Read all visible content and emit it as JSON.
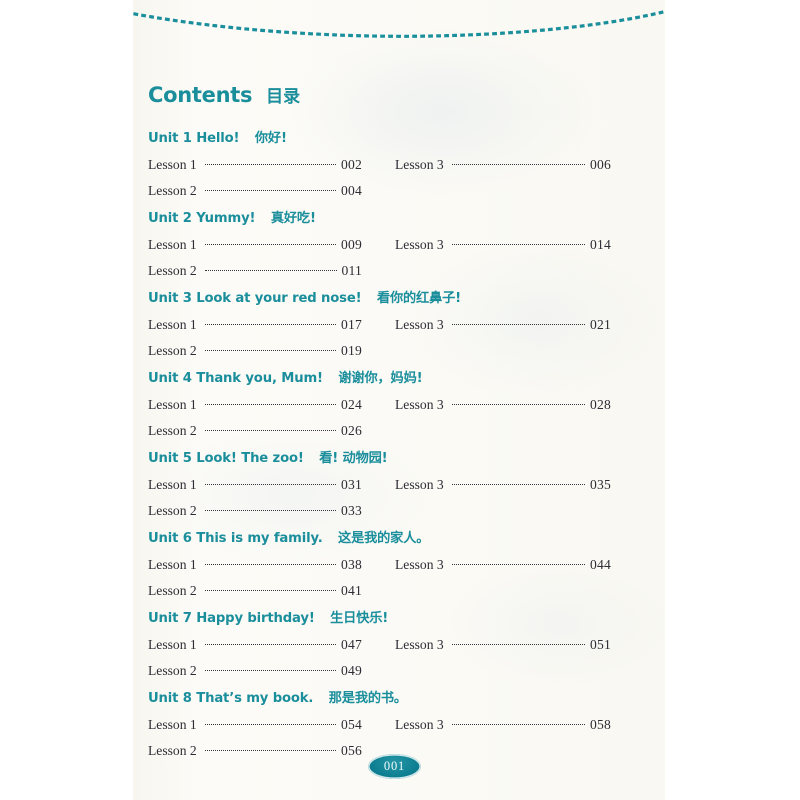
{
  "page": {
    "background_color": "#fbfaf5",
    "accent_color": "#1b8e9c",
    "text_color": "#2d2d35",
    "page_number": "001"
  },
  "header": {
    "title_en": "Contents",
    "title_zh": "目录"
  },
  "decoration": {
    "name": "dotted-wave-line",
    "color": "#1b8e9c"
  },
  "units": [
    {
      "title_en": "Unit 1 Hello!",
      "title_zh": "你好!",
      "lessons_left": [
        {
          "label": "Lesson 1",
          "page": "002"
        },
        {
          "label": "Lesson 2",
          "page": "004"
        }
      ],
      "lessons_right": [
        {
          "label": "Lesson 3",
          "page": "006"
        }
      ]
    },
    {
      "title_en": "Unit 2 Yummy!",
      "title_zh": "真好吃!",
      "lessons_left": [
        {
          "label": "Lesson 1",
          "page": "009"
        },
        {
          "label": "Lesson 2",
          "page": "011"
        }
      ],
      "lessons_right": [
        {
          "label": "Lesson 3",
          "page": "014"
        }
      ]
    },
    {
      "title_en": "Unit 3 Look at your red nose!",
      "title_zh": "看你的红鼻子!",
      "lessons_left": [
        {
          "label": "Lesson 1",
          "page": "017"
        },
        {
          "label": "Lesson 2",
          "page": "019"
        }
      ],
      "lessons_right": [
        {
          "label": "Lesson 3",
          "page": "021"
        }
      ]
    },
    {
      "title_en": "Unit 4 Thank you, Mum!",
      "title_zh": "谢谢你，妈妈!",
      "lessons_left": [
        {
          "label": "Lesson 1",
          "page": "024"
        },
        {
          "label": "Lesson 2",
          "page": "026"
        }
      ],
      "lessons_right": [
        {
          "label": "Lesson 3",
          "page": "028"
        }
      ]
    },
    {
      "title_en": "Unit 5 Look! The zoo!",
      "title_zh": "看! 动物园!",
      "lessons_left": [
        {
          "label": "Lesson 1",
          "page": "031"
        },
        {
          "label": "Lesson 2",
          "page": "033"
        }
      ],
      "lessons_right": [
        {
          "label": "Lesson 3",
          "page": "035"
        }
      ]
    },
    {
      "title_en": "Unit 6 This is my family.",
      "title_zh": "这是我的家人。",
      "lessons_left": [
        {
          "label": "Lesson 1",
          "page": "038"
        },
        {
          "label": "Lesson 2",
          "page": "041"
        }
      ],
      "lessons_right": [
        {
          "label": "Lesson 3",
          "page": "044"
        }
      ]
    },
    {
      "title_en": "Unit 7 Happy birthday!",
      "title_zh": "生日快乐!",
      "lessons_left": [
        {
          "label": "Lesson 1",
          "page": "047"
        },
        {
          "label": "Lesson 2",
          "page": "049"
        }
      ],
      "lessons_right": [
        {
          "label": "Lesson 3",
          "page": "051"
        }
      ]
    },
    {
      "title_en": "Unit 8 That’s my book.",
      "title_zh": "那是我的书。",
      "lessons_left": [
        {
          "label": "Lesson 1",
          "page": "054"
        },
        {
          "label": "Lesson 2",
          "page": "056"
        }
      ],
      "lessons_right": [
        {
          "label": "Lesson 3",
          "page": "058"
        }
      ]
    }
  ]
}
